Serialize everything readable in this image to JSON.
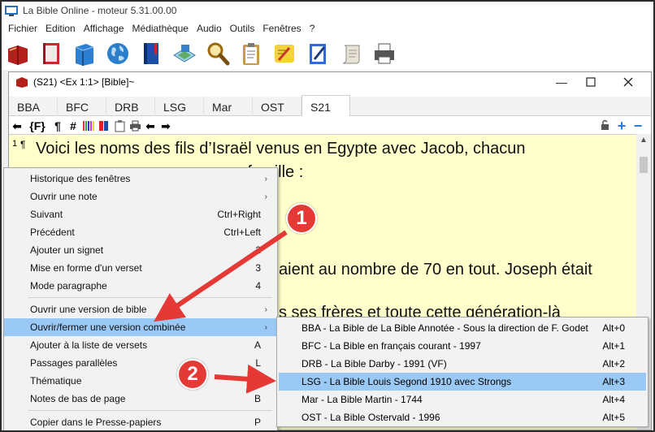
{
  "app": {
    "title": "La Bible Online - moteur 5.31.00.00"
  },
  "menubar": [
    "Fichier",
    "Edition",
    "Affichage",
    "Médiathèque",
    "Audio",
    "Outils",
    "Fenêtres",
    "?"
  ],
  "toolbar_icons": [
    "bible-red-book-icon",
    "bible-book-icon",
    "blue-book-icon",
    "globe-icon",
    "blue-bible-icon",
    "map-icon",
    "magnifier-icon",
    "clipboard-icon",
    "notes-icon",
    "notepad-edit-icon",
    "scroll-icon",
    "printer-icon"
  ],
  "document": {
    "title": "(S21) <Ex 1:1> [Bible]~",
    "tabs": [
      "BBA",
      "BFC",
      "DRB",
      "LSG",
      "Mar",
      "OST",
      "S21"
    ],
    "active_tab": "S21",
    "subtoolbar": {
      "format_label": "{F}",
      "pilcrow": "¶",
      "hash": "#"
    },
    "verse_number": "1",
    "pilcrow": "¶",
    "lines": [
      "Voici les noms des fils d’Israël venus en Egypte avec Jacob, chacun",
      "aient au nombre de 70 en tout. Joseph était",
      "s ses frères et toute cette génération-là"
    ],
    "fragment_behind_menu": "ec sa famille :"
  },
  "context_menu": {
    "items": [
      {
        "label": "Historique des fenêtres",
        "shortcut": "",
        "submenu": true
      },
      {
        "label": "Ouvrir une note",
        "shortcut": "",
        "submenu": true
      },
      {
        "label": "Suivant",
        "shortcut": "Ctrl+Right",
        "submenu": false
      },
      {
        "label": "Précédent",
        "shortcut": "Ctrl+Left",
        "submenu": false
      },
      {
        "label": "Ajouter un signet",
        "shortcut": "2",
        "submenu": false
      },
      {
        "label": "Mise en forme d'un verset",
        "shortcut": "3",
        "submenu": false
      },
      {
        "label": "Mode paragraphe",
        "shortcut": "4",
        "submenu": false
      },
      {
        "label": "Ouvrir une version de bible",
        "shortcut": "",
        "submenu": true
      },
      {
        "label": "Ouvrir/fermer une version combinée",
        "shortcut": "",
        "submenu": true,
        "highlighted": true
      },
      {
        "label": "Ajouter à la liste de versets",
        "shortcut": "A",
        "submenu": false
      },
      {
        "label": "Passages parallèles",
        "shortcut": "L",
        "submenu": false
      },
      {
        "label": "Thématique",
        "shortcut": "",
        "submenu": true
      },
      {
        "label": "Notes de bas de page",
        "shortcut": "B",
        "submenu": false
      },
      {
        "label": "Copier dans le Presse-papiers",
        "shortcut": "P",
        "submenu": false
      }
    ]
  },
  "submenu": {
    "items": [
      {
        "label": "BBA - La Bible de La Bible Annotée - Sous la direction de F. Godet",
        "shortcut": "Alt+0"
      },
      {
        "label": "BFC - La Bible en français courant - 1997",
        "shortcut": "Alt+1"
      },
      {
        "label": "DRB - La Bible Darby - 1991 (VF)",
        "shortcut": "Alt+2"
      },
      {
        "label": "LSG - La Bible Louis Segond 1910 avec Strongs",
        "shortcut": "Alt+3",
        "highlighted": true
      },
      {
        "label": "Mar - La Bible Martin - 1744",
        "shortcut": "Alt+4"
      },
      {
        "label": "OST - La Bible Ostervald - 1996",
        "shortcut": "Alt+5"
      }
    ]
  },
  "annotations": {
    "badge1": "1",
    "badge2": "2",
    "color": "#e53935"
  },
  "colors": {
    "text_bg": "#ffffcc",
    "highlight": "#99c9f4"
  }
}
